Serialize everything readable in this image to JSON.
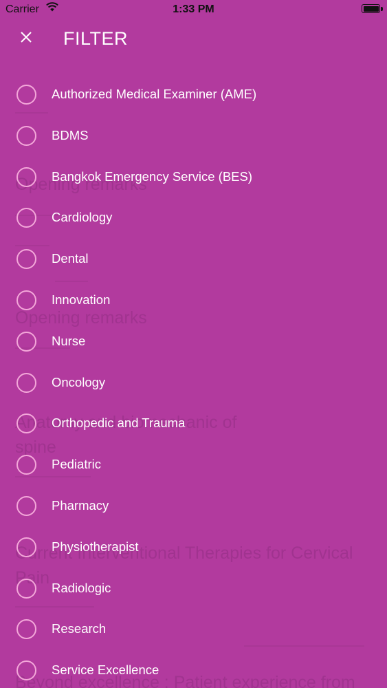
{
  "status_bar": {
    "carrier": "Carrier",
    "time": "1:33 PM",
    "battery_level_percent": 100,
    "wifi_icon": "wifi-icon"
  },
  "header": {
    "title": "FILTER",
    "close_icon": "close-icon"
  },
  "filter_items": [
    {
      "label": "Authorized Medical Examiner (AME)",
      "selected": false
    },
    {
      "label": "BDMS",
      "selected": false
    },
    {
      "label": "Bangkok Emergency Service (BES)",
      "selected": false
    },
    {
      "label": "Cardiology",
      "selected": false
    },
    {
      "label": "Dental",
      "selected": false
    },
    {
      "label": "Innovation",
      "selected": false
    },
    {
      "label": "Nurse",
      "selected": false
    },
    {
      "label": "Oncology",
      "selected": false
    },
    {
      "label": "Orthopedic and Trauma",
      "selected": false
    },
    {
      "label": "Pediatric",
      "selected": false
    },
    {
      "label": "Pharmacy",
      "selected": false
    },
    {
      "label": "Physiotherapist",
      "selected": false
    },
    {
      "label": "Radiologic",
      "selected": false
    },
    {
      "label": "Research",
      "selected": false
    },
    {
      "label": "Service Excellence",
      "selected": false
    }
  ],
  "background_content": {
    "items": [
      {
        "text": "Opening remarks",
        "size": "big"
      },
      {
        "text": "Opening remarks",
        "size": "big"
      },
      {
        "text": "Anatomy and biomechanic of",
        "size": "big"
      },
      {
        "text": "spine",
        "size": "big"
      },
      {
        "text": "Current Interventional Therapies for Cervical",
        "size": "big"
      },
      {
        "text": "Pain",
        "size": "big"
      },
      {
        "text": "Beyond excellence : Patient experience from",
        "size": "big"
      }
    ]
  },
  "colors": {
    "overlay": "#b23a9e",
    "radio_border": "#f3a7d9",
    "text": "#ffffff"
  }
}
